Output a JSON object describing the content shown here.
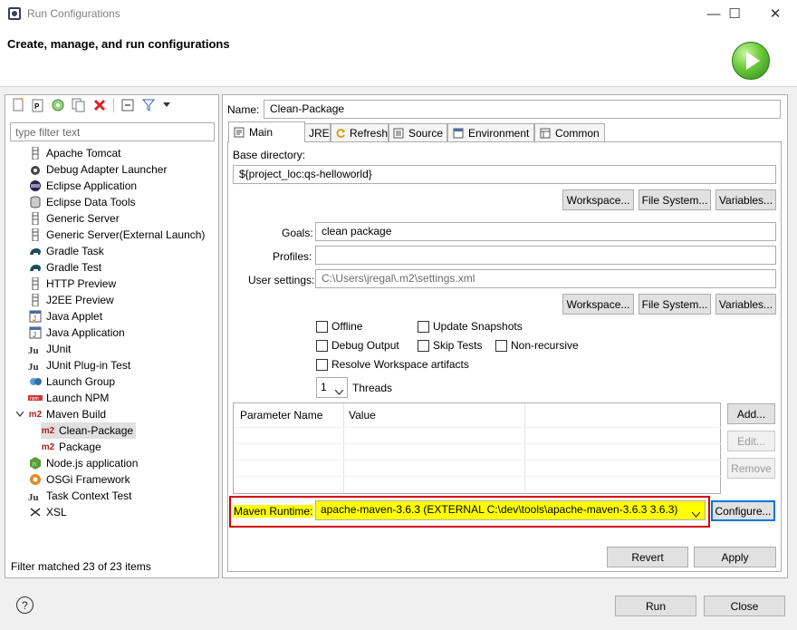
{
  "window": {
    "title": "Run Configurations",
    "header_title": "Create, manage, and run configurations",
    "minimize": "—",
    "maximize": "☐",
    "close": "✕"
  },
  "left": {
    "filter_placeholder": "type filter text",
    "status": "Filter matched 23 of 23 items",
    "items": [
      {
        "label": "Apache Tomcat",
        "icon": "tomcat-icon"
      },
      {
        "label": "Debug Adapter Launcher",
        "icon": "debug-adapter-icon"
      },
      {
        "label": "Eclipse Application",
        "icon": "eclipse-icon"
      },
      {
        "label": "Eclipse Data Tools",
        "icon": "database-icon"
      },
      {
        "label": "Generic Server",
        "icon": "server-icon"
      },
      {
        "label": "Generic Server(External Launch)",
        "icon": "server-icon"
      },
      {
        "label": "Gradle Task",
        "icon": "gradle-icon"
      },
      {
        "label": "Gradle Test",
        "icon": "gradle-icon"
      },
      {
        "label": "HTTP Preview",
        "icon": "http-icon"
      },
      {
        "label": "J2EE Preview",
        "icon": "j2ee-icon"
      },
      {
        "label": "Java Applet",
        "icon": "applet-icon"
      },
      {
        "label": "Java Application",
        "icon": "java-app-icon"
      },
      {
        "label": "JUnit",
        "icon": "junit-icon"
      },
      {
        "label": "JUnit Plug-in Test",
        "icon": "junit-plugin-icon"
      },
      {
        "label": "Launch Group",
        "icon": "launch-group-icon"
      },
      {
        "label": "Launch NPM",
        "icon": "npm-icon"
      },
      {
        "label": "Maven Build",
        "icon": "maven-icon"
      },
      {
        "label": "Clean-Package",
        "icon": "maven-icon"
      },
      {
        "label": "Package",
        "icon": "maven-icon"
      },
      {
        "label": "Node.js application",
        "icon": "nodejs-icon"
      },
      {
        "label": "OSGi Framework",
        "icon": "osgi-icon"
      },
      {
        "label": "Task Context Test",
        "icon": "junit-icon"
      },
      {
        "label": "XSL",
        "icon": "xsl-icon"
      }
    ]
  },
  "main": {
    "name_label": "Name:",
    "name_value": "Clean-Package",
    "tabs": [
      "Main",
      "JRE",
      "Refresh",
      "Source",
      "Environment",
      "Common"
    ],
    "base_dir_label": "Base directory:",
    "base_dir_value": "${project_loc:qs-helloworld}",
    "workspace_btn": "Workspace...",
    "filesystem_btn": "File System...",
    "variables_btn": "Variables...",
    "goals_label": "Goals:",
    "goals_value": "clean package",
    "profiles_label": "Profiles:",
    "profiles_value": "",
    "user_settings_label": "User settings:",
    "user_settings_value": "C:\\Users\\jregal\\.m2\\settings.xml",
    "checkboxes": {
      "offline": "Offline",
      "update_snapshots": "Update Snapshots",
      "debug_output": "Debug Output",
      "skip_tests": "Skip Tests",
      "non_recursive": "Non-recursive",
      "resolve_workspace": "Resolve Workspace artifacts"
    },
    "threads_value": "1",
    "threads_label": "Threads",
    "table_headers": [
      "Parameter Name",
      "Value"
    ],
    "add_btn": "Add...",
    "edit_btn": "Edit...",
    "remove_btn": "Remove",
    "runtime_label": "Maven Runtime:",
    "runtime_value": "apache-maven-3.6.3 (EXTERNAL C:\\dev\\tools\\apache-maven-3.6.3 3.6.3)",
    "configure_btn": "Configure...",
    "revert_btn": "Revert",
    "apply_btn": "Apply"
  },
  "footer": {
    "run_btn": "Run",
    "close_btn": "Close",
    "help": "?"
  }
}
